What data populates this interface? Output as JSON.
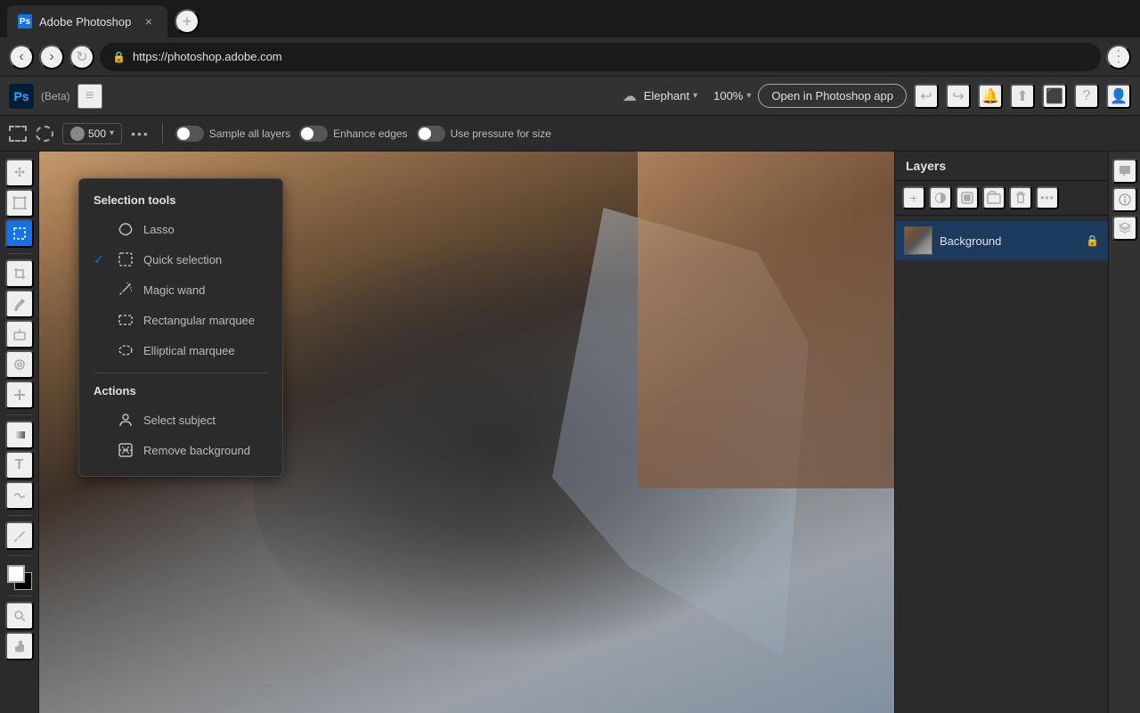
{
  "browser": {
    "tab": {
      "favicon": "Ps",
      "title": "Adobe Photoshop",
      "close": "×"
    },
    "new_tab": "+",
    "nav": {
      "back": "‹",
      "forward": "›",
      "refresh": "↻",
      "url": "https://photoshop.adobe.com",
      "menu": "⋮"
    }
  },
  "app": {
    "logo": "Ps",
    "beta_label": "(Beta)",
    "hamburger": "≡",
    "cloud_icon": "☁",
    "doc_name": "Elephant",
    "zoom": "100%",
    "open_photoshop_btn": "Open in Photoshop app",
    "toolbar_icons": {
      "undo": "↩",
      "redo": "↪",
      "notifications": "🔔",
      "share": "⬆",
      "plugins": "🔌",
      "help": "?",
      "avatar": "👤"
    }
  },
  "options_bar": {
    "size_value": "500",
    "size_chevron": "▾",
    "more": "•••",
    "sample_all_layers": "Sample all layers",
    "enhance_edges": "Enhance edges",
    "use_pressure": "Use pressure for size"
  },
  "tools": {
    "items": [
      {
        "name": "move",
        "icon": "✛"
      },
      {
        "name": "artboard",
        "icon": "⊞"
      },
      {
        "name": "selection",
        "icon": "⬚",
        "active": true
      },
      {
        "name": "crop",
        "icon": "⛶"
      },
      {
        "name": "brush",
        "icon": "🖌"
      },
      {
        "name": "eraser",
        "icon": "◻"
      },
      {
        "name": "stamp",
        "icon": "⊙"
      },
      {
        "name": "healing",
        "icon": "✚"
      },
      {
        "name": "gradient",
        "icon": "▣"
      },
      {
        "name": "type",
        "icon": "T"
      },
      {
        "name": "warp",
        "icon": "⌥"
      },
      {
        "name": "eyedropper",
        "icon": "💉"
      },
      {
        "name": "zoom",
        "icon": "🔍"
      },
      {
        "name": "adjust",
        "icon": "⬍"
      }
    ]
  },
  "selection_panel": {
    "section1_title": "Selection tools",
    "tools": [
      {
        "name": "lasso",
        "label": "Lasso",
        "icon": "◌",
        "checked": false
      },
      {
        "name": "quick-selection",
        "label": "Quick selection",
        "icon": "⬚",
        "checked": true
      },
      {
        "name": "magic-wand",
        "label": "Magic wand",
        "icon": "✦",
        "checked": false
      },
      {
        "name": "rectangular-marquee",
        "label": "Rectangular marquee",
        "icon": "▭",
        "checked": false
      },
      {
        "name": "elliptical-marquee",
        "label": "Elliptical marquee",
        "icon": "⬭",
        "checked": false
      }
    ],
    "section2_title": "Actions",
    "actions": [
      {
        "name": "select-subject",
        "label": "Select subject",
        "icon": "👤"
      },
      {
        "name": "remove-background",
        "label": "Remove background",
        "icon": "🖼"
      }
    ]
  },
  "layers": {
    "title": "Layers",
    "toolbar_buttons": [
      {
        "name": "add",
        "icon": "+"
      },
      {
        "name": "adjustment",
        "icon": "◑"
      },
      {
        "name": "mask",
        "icon": "⬛"
      },
      {
        "name": "group",
        "icon": "⧉"
      },
      {
        "name": "delete",
        "icon": "🗑"
      },
      {
        "name": "more",
        "icon": "•••"
      }
    ],
    "items": [
      {
        "name": "Background",
        "lock": "🔒",
        "selected": true
      }
    ]
  },
  "right_panel_icons": [
    {
      "name": "chat",
      "icon": "💬"
    },
    {
      "name": "info",
      "icon": "ⓘ"
    }
  ]
}
